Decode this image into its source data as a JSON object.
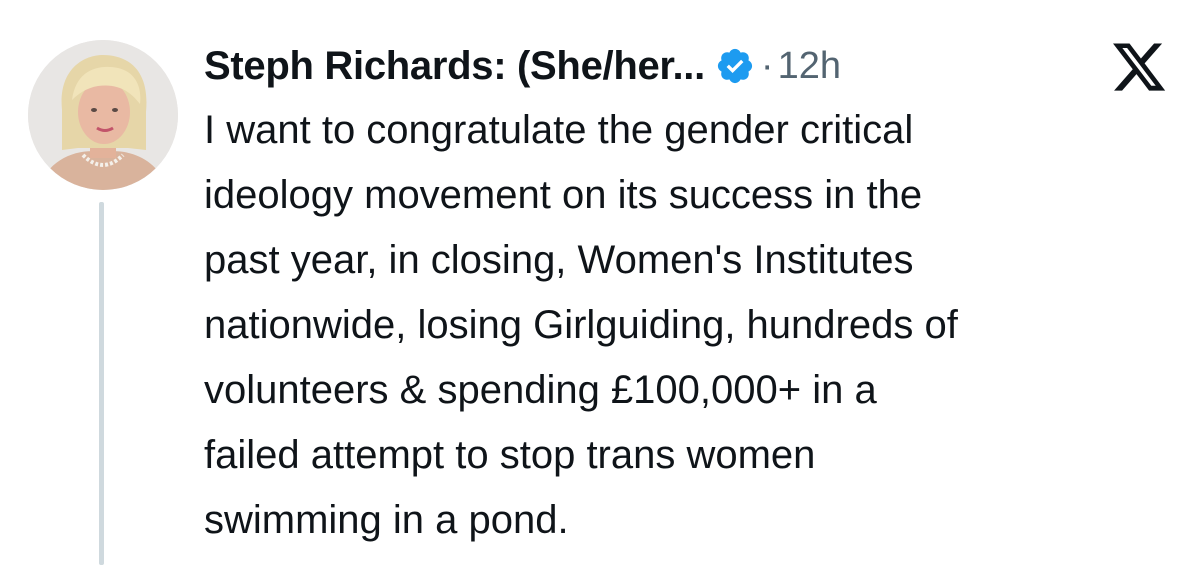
{
  "tweet": {
    "display_name": "Steph Richards: (She/her...",
    "separator": "·",
    "timestamp": "12h",
    "verified_icon": "verified-badge-icon",
    "platform_icon": "x-logo-icon",
    "text_lines": [
      "I want to congratulate the gender critical",
      "ideology movement on its success in the",
      "past year, in closing, Women's Institutes",
      "nationwide, losing Girlguiding, hundreds of",
      "volunteers & spending £100,000+ in a",
      "failed attempt to stop trans women",
      "swimming in a pond."
    ]
  },
  "colors": {
    "verified_blue": "#1d9bf0",
    "text_primary": "#0f1419",
    "text_secondary": "#536471",
    "thread_line": "#cfd9de"
  }
}
